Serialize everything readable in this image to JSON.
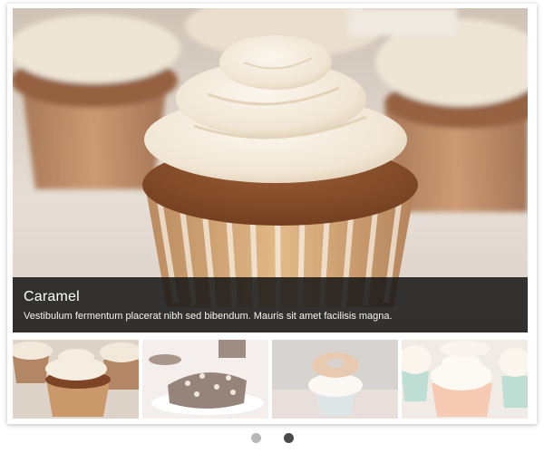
{
  "slider": {
    "current_slide": {
      "title": "Caramel",
      "description": "Vestibulum fermentum placerat nibh sed bibendum. Mauris sit amet facilisis magna."
    },
    "thumbnails": [
      {
        "subject": "caramel cupcakes",
        "active": true
      },
      {
        "subject": "chocolate brownie",
        "active": false
      },
      {
        "subject": "donut cupcake",
        "active": false
      },
      {
        "subject": "pastel cupcakes",
        "active": false
      }
    ],
    "pagination": {
      "pages": 2,
      "active_page": 2
    }
  },
  "colors": {
    "caption_background": "#161616",
    "dot_inactive": "#b7b7b7",
    "dot_active": "#4a4a4a"
  }
}
